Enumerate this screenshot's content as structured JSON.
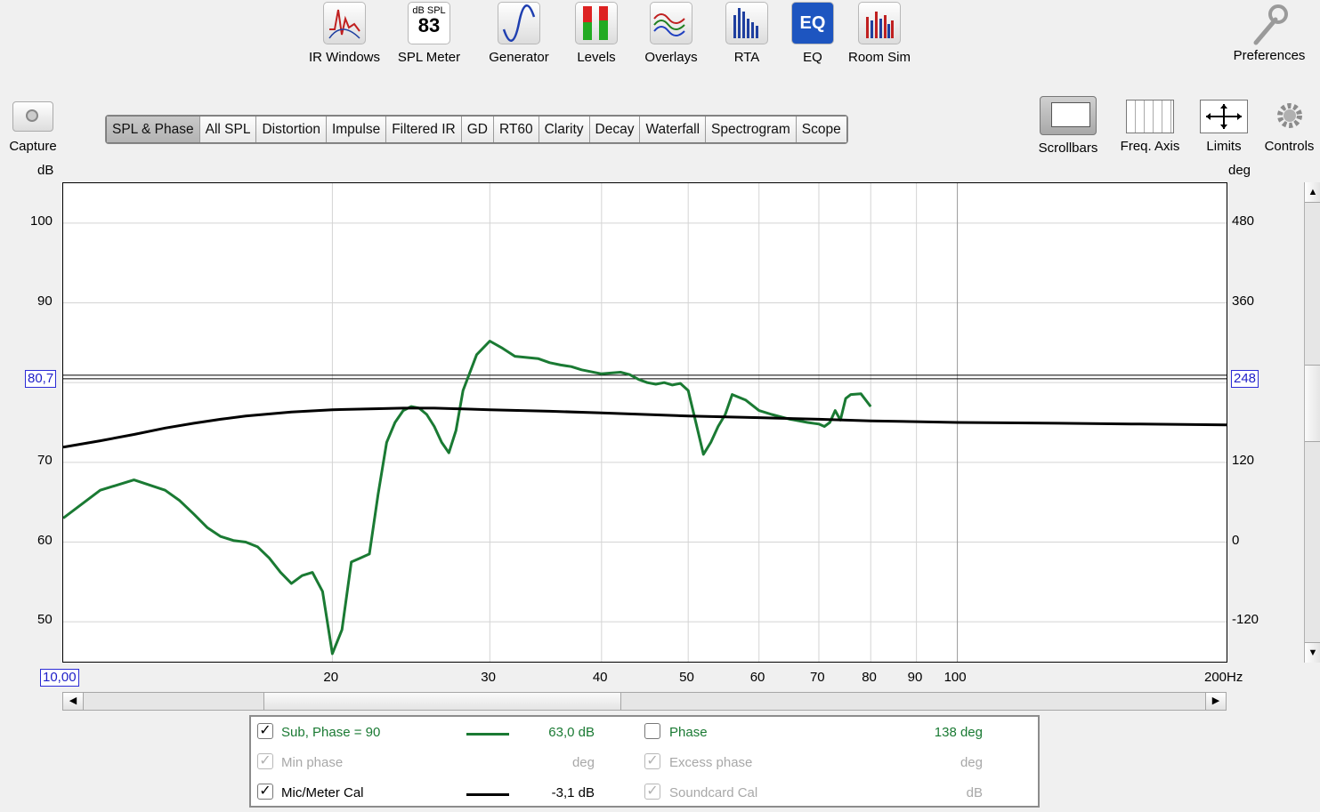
{
  "toolbar": {
    "items": [
      {
        "label": "IR Windows",
        "icon": "ir-windows-icon"
      },
      {
        "label": "SPL Meter",
        "icon": "spl-meter-icon",
        "meter_unit": "dB SPL",
        "meter_value": "83"
      },
      {
        "label": "Generator",
        "icon": "generator-icon"
      },
      {
        "label": "Levels",
        "icon": "levels-icon"
      },
      {
        "label": "Overlays",
        "icon": "overlays-icon"
      },
      {
        "label": "RTA",
        "icon": "rta-icon"
      },
      {
        "label": "EQ",
        "icon": "eq-icon",
        "badge": "EQ"
      },
      {
        "label": "Room Sim",
        "icon": "room-sim-icon"
      }
    ],
    "preferences_label": "Preferences"
  },
  "capture_label": "Capture",
  "tabs": [
    "SPL & Phase",
    "All SPL",
    "Distortion",
    "Impulse",
    "Filtered IR",
    "GD",
    "RT60",
    "Clarity",
    "Decay",
    "Waterfall",
    "Spectrogram",
    "Scope"
  ],
  "active_tab": "SPL & Phase",
  "right_tools": [
    {
      "label": "Scrollbars",
      "icon": "scrollbars-icon"
    },
    {
      "label": "Freq. Axis",
      "icon": "freq-axis-icon"
    },
    {
      "label": "Limits",
      "icon": "limits-icon"
    },
    {
      "label": "Controls",
      "icon": "gear-icon"
    }
  ],
  "axes": {
    "left_unit": "dB",
    "right_unit": "deg",
    "x_unit": "Hz",
    "cursor_spl": "80,7",
    "cursor_phase": "248",
    "x_start": "10,00",
    "x_end": "200"
  },
  "colors": {
    "sub_trace": "#1a7a33",
    "mic_cal_trace": "#000000",
    "cursor_box": "#2020c8"
  },
  "chart_data": {
    "type": "line",
    "x_scale": "log",
    "xlim": [
      10,
      200
    ],
    "ylim": [
      45,
      105
    ],
    "y2lim": [
      -180,
      540
    ],
    "yticks": [
      "100",
      "90",
      "70",
      "60",
      "50"
    ],
    "y_values": [
      100,
      90,
      70,
      60,
      50
    ],
    "y2ticks": [
      "480",
      "360",
      "120",
      "0",
      "-120"
    ],
    "y2_values": [
      480,
      360,
      120,
      0,
      -120
    ],
    "xticks": [
      "20",
      "30",
      "40",
      "50",
      "60",
      "70",
      "80",
      "90",
      "100"
    ],
    "x_values": [
      20,
      30,
      40,
      50,
      60,
      70,
      80,
      90,
      100
    ],
    "x_minor_grid": [
      20,
      30,
      40,
      50,
      60,
      70,
      80,
      90,
      100
    ],
    "grid": true,
    "cursor_y": 80.7,
    "series": [
      {
        "name": "Sub, Phase = 90",
        "color": "#1a7a33",
        "x": [
          10,
          11,
          12,
          13,
          13.5,
          14,
          14.5,
          15,
          15.5,
          16,
          16.5,
          17,
          17.5,
          18,
          18.5,
          19,
          19.5,
          20,
          20.5,
          21,
          21.5,
          22,
          22.5,
          23,
          23.5,
          24,
          24.5,
          25,
          25.5,
          26,
          26.5,
          27,
          27.5,
          28,
          29,
          30,
          31,
          32,
          34,
          35,
          36,
          37,
          38,
          40,
          42,
          43,
          44,
          45,
          46,
          47,
          48,
          49,
          50,
          51,
          52,
          53,
          54,
          55,
          56,
          58,
          60,
          62,
          65,
          68,
          70,
          71,
          72,
          73,
          74,
          75,
          76,
          78,
          80
        ],
        "y": [
          63,
          66.5,
          67.8,
          66.5,
          65.2,
          63.5,
          61.8,
          60.7,
          60.2,
          60.0,
          59.4,
          58.0,
          56.2,
          54.8,
          55.8,
          56.2,
          53.8,
          46.0,
          49,
          57.5,
          58.0,
          58.5,
          66,
          72.5,
          75,
          76.5,
          77,
          76.8,
          76,
          74.5,
          72.5,
          71.2,
          74,
          79,
          83.5,
          85.2,
          84.3,
          83.3,
          83.0,
          82.5,
          82.2,
          82.0,
          81.6,
          81.1,
          81.3,
          81.0,
          80.4,
          80.0,
          79.8,
          80.0,
          79.7,
          79.9,
          79.0,
          75.0,
          71.0,
          72.5,
          74.5,
          76,
          78.5,
          77.8,
          76.5,
          76.0,
          75.4,
          75.0,
          74.8,
          74.5,
          75.0,
          76.5,
          75.3,
          78.0,
          78.5,
          78.6,
          77.0
        ]
      },
      {
        "name": "Mic/Meter Cal",
        "color": "#000000",
        "x": [
          10,
          11,
          12,
          13,
          14,
          15,
          16,
          18,
          20,
          22,
          24,
          26,
          28,
          30,
          35,
          40,
          50,
          60,
          70,
          80,
          100,
          130,
          160,
          200
        ],
        "y": [
          71.9,
          72.7,
          73.5,
          74.3,
          74.9,
          75.4,
          75.8,
          76.3,
          76.6,
          76.7,
          76.8,
          76.8,
          76.7,
          76.6,
          76.4,
          76.2,
          75.8,
          75.6,
          75.4,
          75.2,
          75.0,
          74.9,
          74.8,
          74.7
        ]
      }
    ]
  },
  "legend": {
    "rows": [
      {
        "left_label": "Sub, Phase = 90",
        "left_checked": true,
        "left_dim": false,
        "left_value": "63,0 dB",
        "right_label": "Phase",
        "right_checked": false,
        "right_dim": false,
        "right_value": "138 deg"
      },
      {
        "left_label": "Min phase",
        "left_checked": true,
        "left_dim": true,
        "left_value": "deg",
        "right_label": "Excess phase",
        "right_checked": true,
        "right_dim": true,
        "right_value": "deg"
      },
      {
        "left_label": "Mic/Meter Cal",
        "left_checked": true,
        "left_dim": false,
        "left_value": "-3,1 dB",
        "right_label": "Soundcard Cal",
        "right_checked": true,
        "right_dim": true,
        "right_value": "dB"
      }
    ]
  }
}
